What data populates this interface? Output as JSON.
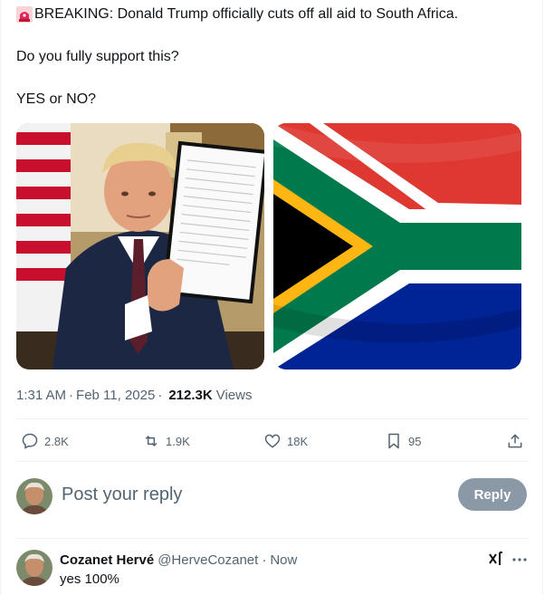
{
  "tweet": {
    "emoji": "siren-emoji",
    "line1": "BREAKING: Donald Trump officially cuts off all aid to South Africa.",
    "line2": "Do you fully support this?",
    "line3": "YES or NO?",
    "media": [
      {
        "name": "photo-trump-holding-document"
      },
      {
        "name": "photo-south-africa-flag"
      }
    ],
    "time": "1:31 AM",
    "date": "Feb 11, 2025",
    "views": "212.3K",
    "views_label": "Views",
    "dot": "·"
  },
  "actions": {
    "replies": "2.8K",
    "reposts": "1.9K",
    "likes": "18K",
    "bookmarks": "95"
  },
  "composer": {
    "placeholder": "Post your reply",
    "reply_button": "Reply"
  },
  "reply": {
    "name": "Cozanet Hervé",
    "handle": "@HerveCozanet",
    "time_sep": "·",
    "time": "Now",
    "text": "yes 100%"
  },
  "colors": {
    "text": "#0f1419",
    "secondary": "#536471",
    "reply_button_bg": "#8b98a5",
    "divider": "#eff3f4"
  }
}
